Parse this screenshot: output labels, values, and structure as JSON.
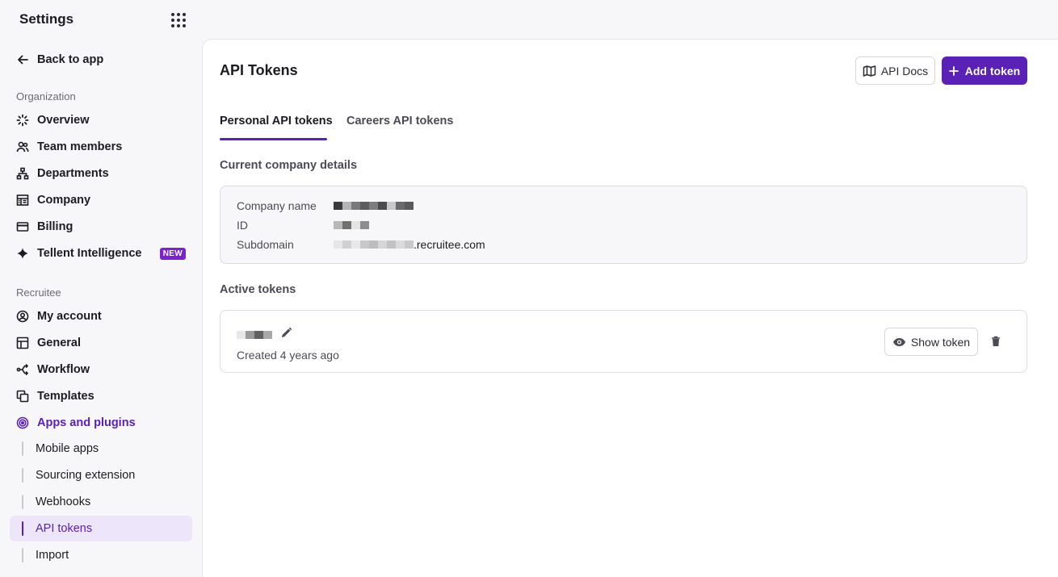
{
  "app": {
    "title": "Settings"
  },
  "sidebar": {
    "back_label": "Back to app",
    "sections": [
      {
        "label": "Organization"
      },
      {
        "label": "Recruitee"
      }
    ],
    "org_items": [
      {
        "label": "Overview",
        "icon": "sparkle-burst-icon"
      },
      {
        "label": "Team members",
        "icon": "users-icon"
      },
      {
        "label": "Departments",
        "icon": "hierarchy-icon"
      },
      {
        "label": "Company",
        "icon": "building-icon"
      },
      {
        "label": "Billing",
        "icon": "credit-card-icon"
      },
      {
        "label": "Tellent Intelligence",
        "icon": "sparkle-icon",
        "badge": "NEW"
      }
    ],
    "recruitee_items": [
      {
        "label": "My account",
        "icon": "user-circle-icon"
      },
      {
        "label": "General",
        "icon": "layout-icon"
      },
      {
        "label": "Workflow",
        "icon": "workflow-icon"
      },
      {
        "label": "Templates",
        "icon": "templates-icon"
      },
      {
        "label": "Apps and plugins",
        "icon": "target-icon"
      }
    ],
    "sub_items": [
      {
        "label": "Mobile apps"
      },
      {
        "label": "Sourcing extension"
      },
      {
        "label": "Webhooks"
      },
      {
        "label": "API tokens"
      },
      {
        "label": "Import"
      }
    ]
  },
  "main": {
    "title": "API Tokens",
    "docs_button": "API Docs",
    "add_button": "Add token",
    "tabs": [
      {
        "label": "Personal API tokens"
      },
      {
        "label": "Careers API tokens"
      }
    ],
    "company_heading": "Current company details",
    "company": {
      "name_label": "Company name",
      "id_label": "ID",
      "subdomain_label": "Subdomain",
      "subdomain_suffix": ".recruitee.com"
    },
    "active_heading": "Active tokens",
    "token": {
      "created": "Created 4 years ago",
      "show_button": "Show token"
    }
  },
  "colors": {
    "accent": "#5b21b6",
    "badge": "#7e22ce"
  }
}
